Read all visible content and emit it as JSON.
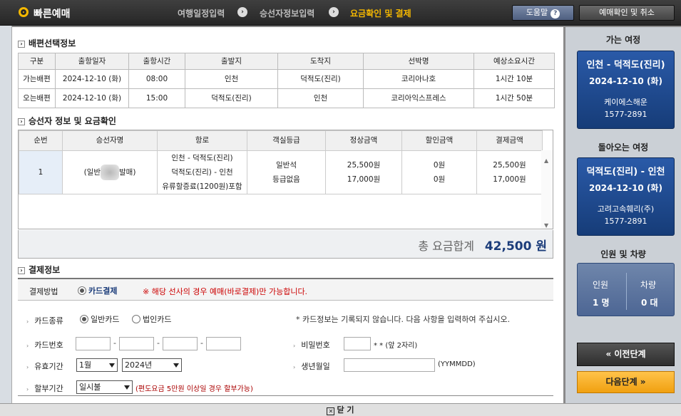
{
  "header": {
    "title": "빠른예매",
    "steps": [
      "여행일정입력",
      "승선자정보입력",
      "요금확인 및 결제"
    ],
    "help_label": "도움말",
    "confirm_label": "예매확인 및 취소"
  },
  "schedule": {
    "section_title": "배편선택정보",
    "columns": [
      "구분",
      "출항일자",
      "출항시간",
      "출발지",
      "도착지",
      "선박명",
      "예상소요시간"
    ],
    "rows": [
      [
        "가는배편",
        "2024-12-10 (화)",
        "08:00",
        "인천",
        "덕적도(진리)",
        "코리아나호",
        "1시간 10분"
      ],
      [
        "오는배편",
        "2024-12-10 (화)",
        "15:00",
        "덕적도(진리)",
        "인천",
        "코리아익스프레스",
        "1시간 50분"
      ]
    ]
  },
  "passengers": {
    "section_title": "승선자 정보 및 요금확인",
    "columns": [
      "순번",
      "승선자명",
      "항로",
      "객실등급",
      "정상금액",
      "할인금액",
      "결제금액"
    ],
    "row": {
      "no": "1",
      "name": "(일반",
      "name_suffix": "발매)",
      "routes": [
        "인천 - 덕적도(진리)",
        "덕적도(진리) - 인천",
        "유류할증료(1200원)포함"
      ],
      "grades": [
        "일반석",
        "등급없음"
      ],
      "normal": [
        "25,500원",
        "17,000원"
      ],
      "discount": [
        "0원",
        "0원"
      ],
      "payment": [
        "25,500원",
        "17,000원"
      ]
    },
    "total_label": "총 요금합계",
    "total_value": "42,500 원"
  },
  "payment": {
    "section_title": "결제정보",
    "method_label": "결제방법",
    "method_value": "카드결제",
    "method_notice": "※ 해당 선사의 경우 예매(바로결제)만 가능합니다.",
    "card_type_label": "카드종류",
    "card_personal": "일반카드",
    "card_corporate": "법인카드",
    "card_notice": "* 카드정보는 기록되지 않습니다. 다음 사항을 입력하여 주십시오.",
    "card_number_label": "카드번호",
    "password_label": "비밀번호",
    "password_hint": "* * (앞 2자리)",
    "expiry_label": "유효기간",
    "expiry_month": "1월",
    "expiry_year": "2024년",
    "birth_label": "생년월일",
    "birth_hint": "(YYMMDD)",
    "installment_label": "할부기간",
    "installment_value": "일시불",
    "installment_note": "(편도요금 5만원 이상일 경우 할부가능)"
  },
  "side": {
    "outbound_title": "가는 여정",
    "outbound_route": "인천 - 덕적도(진리)",
    "outbound_date": "2024-12-10 (화)",
    "outbound_operator": "케이에스해운",
    "outbound_phone": "1577-2891",
    "return_title": "돌아오는 여정",
    "return_route": "덕적도(진리) - 인천",
    "return_date": "2024-12-10 (화)",
    "return_operator": "고려고속훼리(주)",
    "return_phone": "1577-2891",
    "people_title": "인원 및 차량",
    "people_label": "인원",
    "people_value": "1 명",
    "vehicle_label": "차량",
    "vehicle_value": "0 대",
    "prev_label": "«  이전단계",
    "next_label": "다음단계  »"
  },
  "footer": {
    "close_label": "닫 기"
  }
}
